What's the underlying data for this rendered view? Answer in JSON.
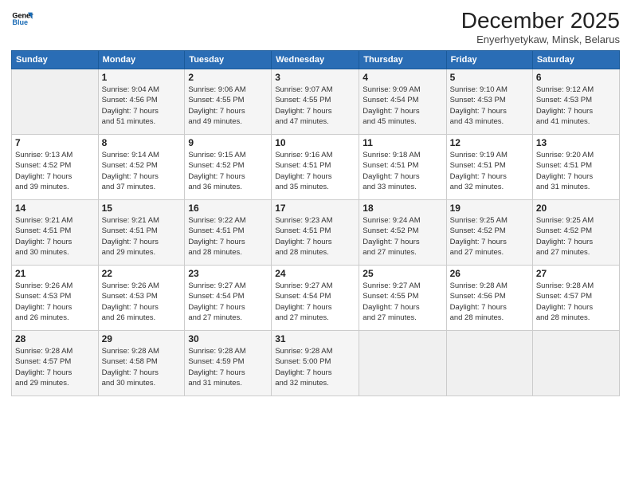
{
  "logo": {
    "line1": "General",
    "line2": "Blue"
  },
  "header": {
    "title": "December 2025",
    "subtitle": "Enyerhyetykaw, Minsk, Belarus"
  },
  "weekdays": [
    "Sunday",
    "Monday",
    "Tuesday",
    "Wednesday",
    "Thursday",
    "Friday",
    "Saturday"
  ],
  "weeks": [
    [
      {
        "day": "",
        "info": ""
      },
      {
        "day": "1",
        "info": "Sunrise: 9:04 AM\nSunset: 4:56 PM\nDaylight: 7 hours\nand 51 minutes."
      },
      {
        "day": "2",
        "info": "Sunrise: 9:06 AM\nSunset: 4:55 PM\nDaylight: 7 hours\nand 49 minutes."
      },
      {
        "day": "3",
        "info": "Sunrise: 9:07 AM\nSunset: 4:55 PM\nDaylight: 7 hours\nand 47 minutes."
      },
      {
        "day": "4",
        "info": "Sunrise: 9:09 AM\nSunset: 4:54 PM\nDaylight: 7 hours\nand 45 minutes."
      },
      {
        "day": "5",
        "info": "Sunrise: 9:10 AM\nSunset: 4:53 PM\nDaylight: 7 hours\nand 43 minutes."
      },
      {
        "day": "6",
        "info": "Sunrise: 9:12 AM\nSunset: 4:53 PM\nDaylight: 7 hours\nand 41 minutes."
      }
    ],
    [
      {
        "day": "7",
        "info": "Sunrise: 9:13 AM\nSunset: 4:52 PM\nDaylight: 7 hours\nand 39 minutes."
      },
      {
        "day": "8",
        "info": "Sunrise: 9:14 AM\nSunset: 4:52 PM\nDaylight: 7 hours\nand 37 minutes."
      },
      {
        "day": "9",
        "info": "Sunrise: 9:15 AM\nSunset: 4:52 PM\nDaylight: 7 hours\nand 36 minutes."
      },
      {
        "day": "10",
        "info": "Sunrise: 9:16 AM\nSunset: 4:51 PM\nDaylight: 7 hours\nand 35 minutes."
      },
      {
        "day": "11",
        "info": "Sunrise: 9:18 AM\nSunset: 4:51 PM\nDaylight: 7 hours\nand 33 minutes."
      },
      {
        "day": "12",
        "info": "Sunrise: 9:19 AM\nSunset: 4:51 PM\nDaylight: 7 hours\nand 32 minutes."
      },
      {
        "day": "13",
        "info": "Sunrise: 9:20 AM\nSunset: 4:51 PM\nDaylight: 7 hours\nand 31 minutes."
      }
    ],
    [
      {
        "day": "14",
        "info": "Sunrise: 9:21 AM\nSunset: 4:51 PM\nDaylight: 7 hours\nand 30 minutes."
      },
      {
        "day": "15",
        "info": "Sunrise: 9:21 AM\nSunset: 4:51 PM\nDaylight: 7 hours\nand 29 minutes."
      },
      {
        "day": "16",
        "info": "Sunrise: 9:22 AM\nSunset: 4:51 PM\nDaylight: 7 hours\nand 28 minutes."
      },
      {
        "day": "17",
        "info": "Sunrise: 9:23 AM\nSunset: 4:51 PM\nDaylight: 7 hours\nand 28 minutes."
      },
      {
        "day": "18",
        "info": "Sunrise: 9:24 AM\nSunset: 4:52 PM\nDaylight: 7 hours\nand 27 minutes."
      },
      {
        "day": "19",
        "info": "Sunrise: 9:25 AM\nSunset: 4:52 PM\nDaylight: 7 hours\nand 27 minutes."
      },
      {
        "day": "20",
        "info": "Sunrise: 9:25 AM\nSunset: 4:52 PM\nDaylight: 7 hours\nand 27 minutes."
      }
    ],
    [
      {
        "day": "21",
        "info": "Sunrise: 9:26 AM\nSunset: 4:53 PM\nDaylight: 7 hours\nand 26 minutes."
      },
      {
        "day": "22",
        "info": "Sunrise: 9:26 AM\nSunset: 4:53 PM\nDaylight: 7 hours\nand 26 minutes."
      },
      {
        "day": "23",
        "info": "Sunrise: 9:27 AM\nSunset: 4:54 PM\nDaylight: 7 hours\nand 27 minutes."
      },
      {
        "day": "24",
        "info": "Sunrise: 9:27 AM\nSunset: 4:54 PM\nDaylight: 7 hours\nand 27 minutes."
      },
      {
        "day": "25",
        "info": "Sunrise: 9:27 AM\nSunset: 4:55 PM\nDaylight: 7 hours\nand 27 minutes."
      },
      {
        "day": "26",
        "info": "Sunrise: 9:28 AM\nSunset: 4:56 PM\nDaylight: 7 hours\nand 28 minutes."
      },
      {
        "day": "27",
        "info": "Sunrise: 9:28 AM\nSunset: 4:57 PM\nDaylight: 7 hours\nand 28 minutes."
      }
    ],
    [
      {
        "day": "28",
        "info": "Sunrise: 9:28 AM\nSunset: 4:57 PM\nDaylight: 7 hours\nand 29 minutes."
      },
      {
        "day": "29",
        "info": "Sunrise: 9:28 AM\nSunset: 4:58 PM\nDaylight: 7 hours\nand 30 minutes."
      },
      {
        "day": "30",
        "info": "Sunrise: 9:28 AM\nSunset: 4:59 PM\nDaylight: 7 hours\nand 31 minutes."
      },
      {
        "day": "31",
        "info": "Sunrise: 9:28 AM\nSunset: 5:00 PM\nDaylight: 7 hours\nand 32 minutes."
      },
      {
        "day": "",
        "info": ""
      },
      {
        "day": "",
        "info": ""
      },
      {
        "day": "",
        "info": ""
      }
    ]
  ]
}
